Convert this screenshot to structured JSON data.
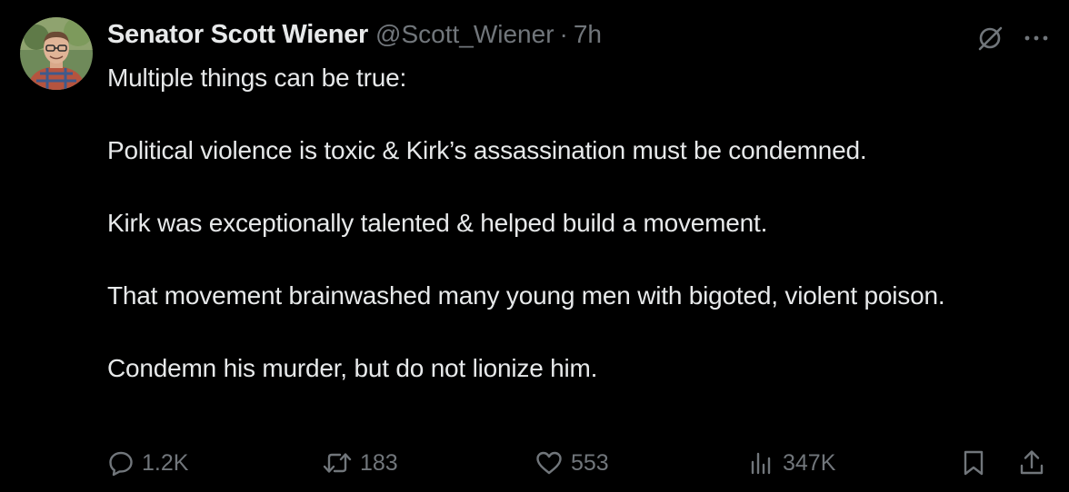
{
  "post": {
    "author": {
      "display_name": "Senator Scott Wiener",
      "handle": "@Scott_Wiener",
      "separator": "·",
      "time": "7h",
      "avatar_icon": "avatar-photo"
    },
    "paragraphs": [
      "Multiple things can be true:",
      "Political violence is toxic & Kirk’s assassination must be condemned.",
      "Kirk was exceptionally talented & helped build a movement.",
      "That movement brainwashed many young men with bigoted, violent poison.",
      "Condemn his murder, but do not lionize him."
    ],
    "top_icons": [
      "grok-icon",
      "more-icon"
    ],
    "metrics": {
      "replies": "1.2K",
      "reposts": "183",
      "likes": "553",
      "views": "347K"
    }
  },
  "colors": {
    "background": "#000000",
    "text": "#e7e9ea",
    "secondary": "#71767b"
  }
}
